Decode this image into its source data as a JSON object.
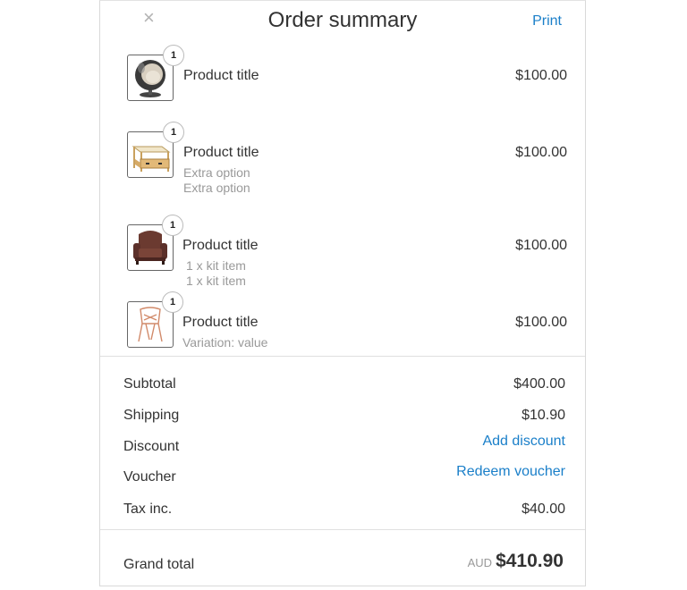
{
  "header": {
    "close_glyph": "×",
    "title": "Order summary",
    "print_label": "Print"
  },
  "items": [
    {
      "quantity": "1",
      "title": "Product title",
      "price": "$100.00",
      "sub": [],
      "icon": "egg-chair-image"
    },
    {
      "quantity": "1",
      "title": "Product title",
      "price": "$100.00",
      "sub": [
        "Extra option",
        "Extra option"
      ],
      "icon": "coffee-table-image"
    },
    {
      "quantity": "1",
      "title": "Product title",
      "price": "$100.00",
      "sub": [
        "1 x kit item",
        "1 x kit item"
      ],
      "icon": "armchair-image"
    },
    {
      "quantity": "1",
      "title": "Product title",
      "price": "$100.00",
      "sub": [
        "Variation: value"
      ],
      "icon": "wire-chair-image"
    }
  ],
  "totals": {
    "subtotal_label": "Subtotal",
    "subtotal_value": "$400.00",
    "shipping_label": "Shipping",
    "shipping_value": "$10.90",
    "discount_label": "Discount",
    "discount_link": "Add discount",
    "voucher_label": "Voucher",
    "voucher_link": "Redeem voucher",
    "tax_label": "Tax inc.",
    "tax_value": "$40.00"
  },
  "grand_total": {
    "label": "Grand total",
    "currency": "AUD",
    "value": "$410.90"
  },
  "colors": {
    "link": "#1a7fc9",
    "text": "#333333",
    "muted": "#999999"
  }
}
